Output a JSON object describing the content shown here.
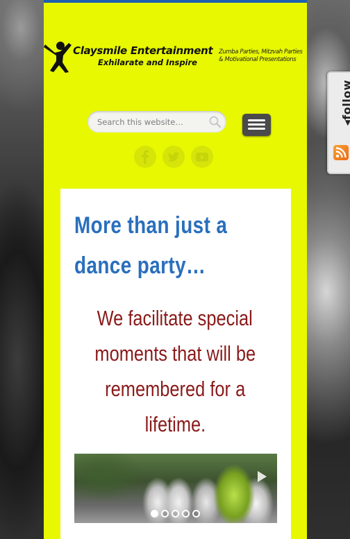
{
  "site": {
    "brand": "Claysmile Entertainment",
    "tagline": "Exhilarate and Inspire",
    "services_line1": "Zumba Parties, Mitzvah Parties",
    "services_line2": "& Motivational Presentations"
  },
  "search": {
    "placeholder": "Search this website…"
  },
  "social": {
    "items": [
      "facebook-icon",
      "twitter-icon",
      "youtube-icon"
    ]
  },
  "content": {
    "headline_line1": "More than just a",
    "headline_line2": "dance party…",
    "sub_line1": "We facilitate special",
    "sub_line2": "moments that will be",
    "sub_line3": "remembered for a",
    "sub_line4": "lifetime."
  },
  "slider": {
    "slides": 5,
    "active_slide": 1
  },
  "follow_widget": {
    "label": "◂follow"
  },
  "colors": {
    "column_bg": "#e8f800",
    "accent_blue": "#2a6fbd",
    "accent_red": "#8a1a1a",
    "menu_button": "#4a4a4a"
  }
}
